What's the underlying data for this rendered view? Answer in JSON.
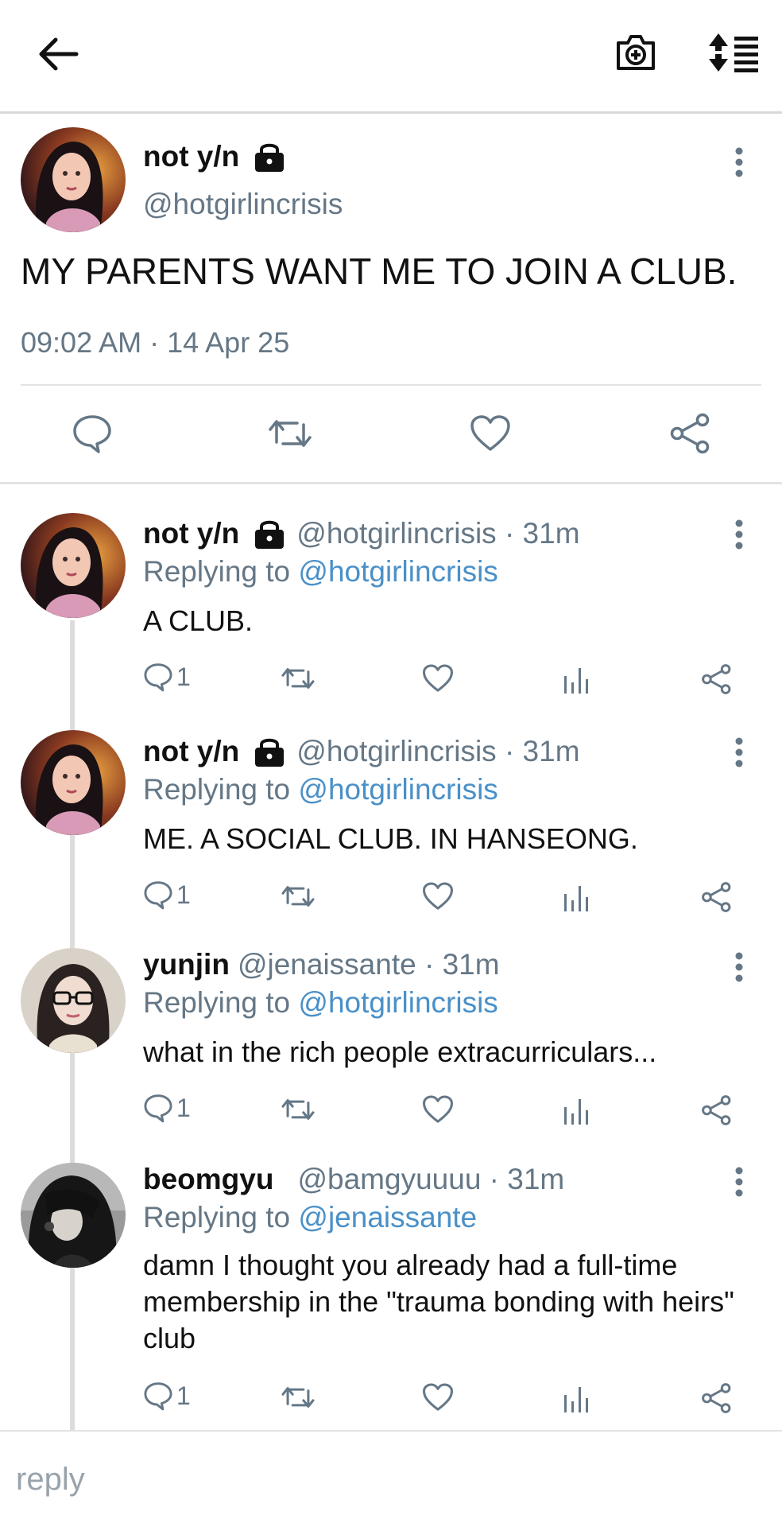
{
  "header": {
    "back_icon": "arrow-left-icon",
    "camera_icon": "camera-add-icon",
    "sort_icon": "sort-list-icon"
  },
  "main_tweet": {
    "name": "not y/n",
    "handle": "@hotgirlincrisis",
    "text": "MY PARENTS WANT ME TO JOIN A CLUB.",
    "timestamp": "09:02 AM · 14 Apr 25"
  },
  "replies": [
    {
      "name": "not y/n",
      "handle": "@hotgirlincrisis · 31m",
      "replying_prefix": "Replying to ",
      "replying_to": "@hotgirlincrisis",
      "text": "A CLUB.",
      "reply_count": "1"
    },
    {
      "name": "not y/n",
      "handle": "@hotgirlincrisis · 31m",
      "replying_prefix": "Replying to ",
      "replying_to": "@hotgirlincrisis",
      "text": "ME. A SOCIAL CLUB. IN HANSEONG.",
      "reply_count": "1"
    },
    {
      "name": "yunjin",
      "handle": "@jenaissante · 31m",
      "replying_prefix": "Replying to ",
      "replying_to": "@hotgirlincrisis",
      "text": "what in the rich people extracurriculars...",
      "reply_count": "1"
    },
    {
      "name": "beomgyu",
      "handle": "@bamgyuuuu · 31m",
      "replying_prefix": "Replying to ",
      "replying_to": "@jenaissante",
      "text": "damn I thought you already had a full-time membership in the \"trauma bonding with heirs\" club",
      "reply_count": "1"
    }
  ],
  "composer": {
    "placeholder": "reply"
  },
  "colors": {
    "link": "#4a90c8",
    "meta": "#657786",
    "divider": "#e3e3e3"
  }
}
